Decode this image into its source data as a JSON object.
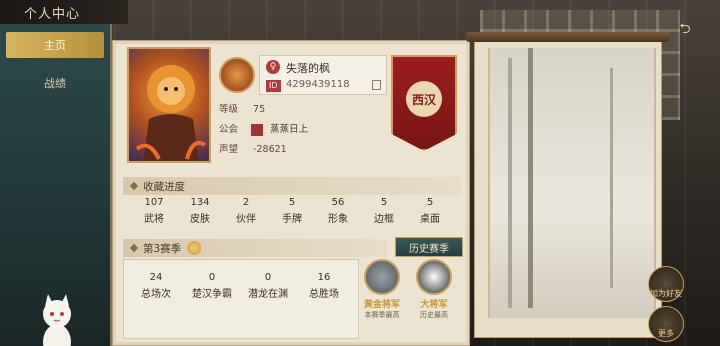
{
  "header": {
    "title": "个人中心"
  },
  "sidebar": {
    "items": [
      {
        "label": "主页",
        "active": true
      },
      {
        "label": "战绩",
        "active": false
      }
    ]
  },
  "profile": {
    "name": "失落的枫",
    "id_tag": "ID",
    "id_value": "4299439118",
    "level_label": "等级",
    "level_value": "75",
    "guild_label": "公会",
    "guild_value": "蒸蒸日上",
    "reputation_label": "声望",
    "reputation_value": "-28621",
    "faction": "西汉"
  },
  "collection": {
    "title": "收藏进度",
    "stats": [
      {
        "value": "107",
        "label": "武将"
      },
      {
        "value": "134",
        "label": "皮肤"
      },
      {
        "value": "2",
        "label": "伙伴"
      },
      {
        "value": "5",
        "label": "手牌"
      },
      {
        "value": "56",
        "label": "形象"
      },
      {
        "value": "5",
        "label": "边框"
      },
      {
        "value": "5",
        "label": "桌面"
      }
    ]
  },
  "season": {
    "title": "第3赛季",
    "history_button": "历史赛季",
    "stats": [
      {
        "value": "24",
        "label": "总场次"
      },
      {
        "value": "0",
        "label": "楚汉争霸"
      },
      {
        "value": "0",
        "label": "潜龙在渊"
      },
      {
        "value": "16",
        "label": "总胜场"
      }
    ],
    "ranks": [
      {
        "name": "黄金将军",
        "sub": "本赛季最高"
      },
      {
        "name": "大将军",
        "sub": "历史最高"
      }
    ]
  },
  "right_buttons": {
    "add_friend": "加为好友",
    "more": "更多"
  },
  "colors": {
    "accent_gold": "#c9a25a",
    "banner_red": "#9c1e1e",
    "sidebar_teal": "#2d4a4a"
  }
}
